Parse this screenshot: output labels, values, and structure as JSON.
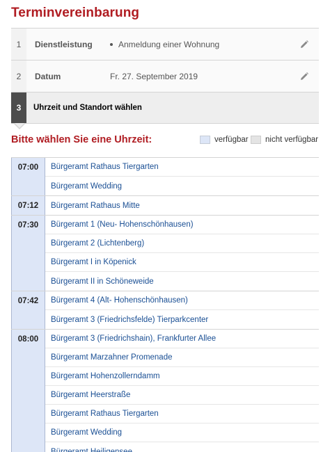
{
  "page": {
    "title": "Terminvereinbarung"
  },
  "steps": [
    {
      "number": "1",
      "label": "Dienstleistung",
      "value": "Anmeldung einer Wohnung",
      "bulleted": true
    },
    {
      "number": "2",
      "label": "Datum",
      "value": "Fr. 27. September 2019",
      "bulleted": false
    },
    {
      "number": "3",
      "label": "Uhrzeit und Standort wählen"
    }
  ],
  "prompt": "Bitte wählen Sie eine Uhrzeit:",
  "legend": {
    "available": "verfügbar",
    "unavailable": "nicht verfügbar"
  },
  "colors": {
    "brand_red": "#b01c22",
    "available": "#dde6f7",
    "unavailable": "#e4e4e4",
    "link": "#1a4f94"
  },
  "slots": [
    {
      "time": "07:00",
      "offices": [
        "Bürgeramt Rathaus Tiergarten",
        "Bürgeramt Wedding"
      ]
    },
    {
      "time": "07:12",
      "offices": [
        "Bürgeramt Rathaus Mitte"
      ]
    },
    {
      "time": "07:30",
      "offices": [
        "Bürgeramt 1 (Neu- Hohenschönhausen)",
        "Bürgeramt 2 (Lichtenberg)",
        "Bürgeramt I in Köpenick",
        "Bürgeramt II in Schöneweide"
      ]
    },
    {
      "time": "07:42",
      "offices": [
        "Bürgeramt 4 (Alt- Hohenschönhausen)",
        "Bürgeramt 3 (Friedrichsfelde) Tierparkcenter"
      ]
    },
    {
      "time": "08:00",
      "offices": [
        "Bürgeramt 3 (Friedrichshain), Frankfurter Allee",
        "Bürgeramt Marzahner Promenade",
        "Bürgeramt Hohenzollerndamm",
        "Bürgeramt Heerstraße",
        "Bürgeramt Rathaus Tiergarten",
        "Bürgeramt Wedding",
        "Bürgeramt Heiligensee"
      ]
    }
  ]
}
